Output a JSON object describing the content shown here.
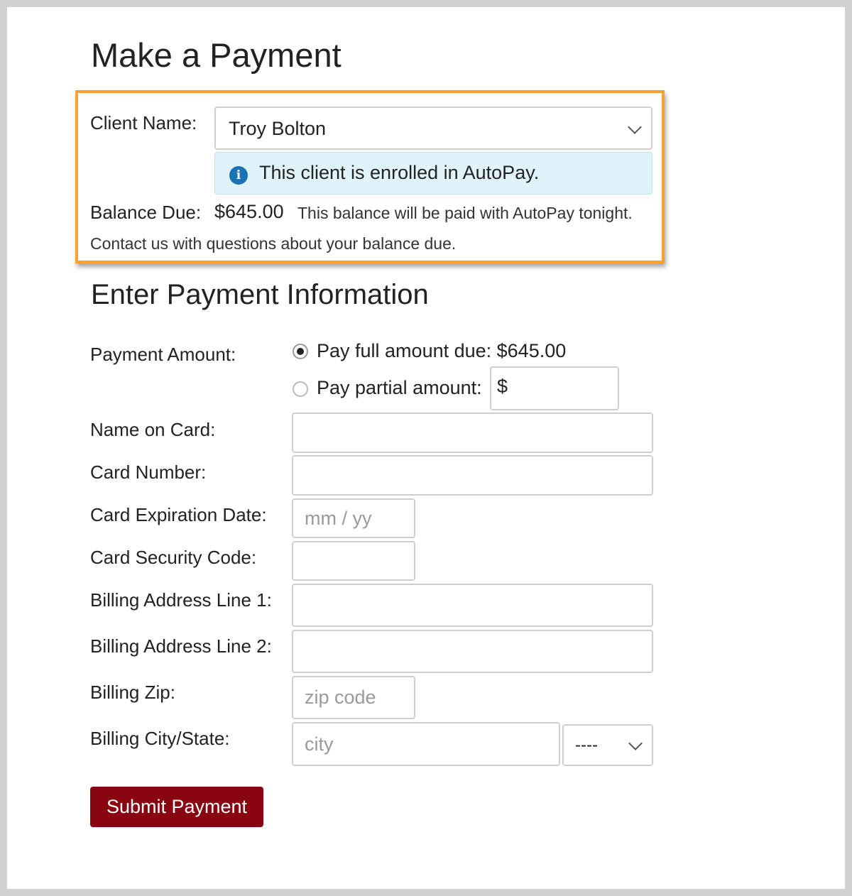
{
  "page": {
    "title": "Make a Payment"
  },
  "client": {
    "label": "Client Name:",
    "selected": "Troy Bolton",
    "autopay_notice": "This client is enrolled in AutoPay.",
    "balance_label": "Balance Due:",
    "balance_value": "$645.00",
    "autopay_note": "This balance will be paid with AutoPay tonight.",
    "contact_note": "Contact us with questions about your balance due."
  },
  "form": {
    "section_title": "Enter Payment Information",
    "payment_amount_label": "Payment Amount:",
    "pay_full_label": "Pay full amount due: $645.00",
    "pay_full_checked": true,
    "pay_partial_label": "Pay partial amount:",
    "currency_symbol": "$",
    "partial_amount_value": "",
    "name_on_card_label": "Name on Card:",
    "card_number_label": "Card Number:",
    "expiration_label": "Card Expiration Date:",
    "expiration_placeholder": "mm / yy",
    "security_code_label": "Card Security Code:",
    "address1_label": "Billing Address Line 1:",
    "address2_label": "Billing Address Line 2:",
    "zip_label": "Billing Zip:",
    "zip_placeholder": "zip code",
    "city_state_label": "Billing City/State:",
    "city_placeholder": "city",
    "state_selected": "----",
    "submit_label": "Submit Payment"
  },
  "colors": {
    "highlight_border": "#f7a134",
    "info_background": "#e1f3fa",
    "info_icon": "#1a73b5",
    "submit_background": "#8a0512"
  },
  "icons": {
    "info": "info-icon",
    "dropdown": "chevron-down-icon"
  }
}
